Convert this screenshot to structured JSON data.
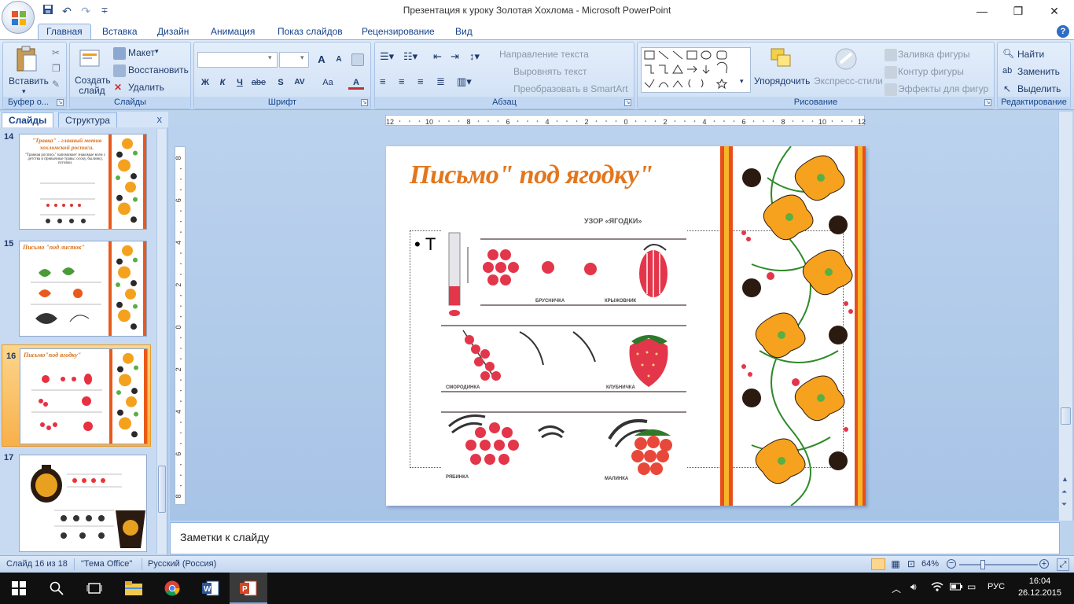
{
  "window": {
    "title": "Презентация к уроку Золотая Хохлома - Microsoft PowerPoint"
  },
  "quick_access": {
    "icons": [
      "save-icon",
      "undo-icon",
      "redo-icon",
      "customize-icon"
    ],
    "customize_glyph": "∓"
  },
  "window_controls": {
    "minimize": "—",
    "restore": "❐",
    "close": "✕"
  },
  "tabs": [
    "Главная",
    "Вставка",
    "Дизайн",
    "Анимация",
    "Показ слайдов",
    "Рецензирование",
    "Вид"
  ],
  "ribbon": {
    "clipboard": {
      "paste": "Вставить",
      "label": "Буфер о..."
    },
    "slides": {
      "new_slide": "Создать слайд",
      "layout": "Макет",
      "reset": "Восстановить",
      "delete": "Удалить",
      "label": "Слайды"
    },
    "font": {
      "label": "Шрифт",
      "bold": "Ж",
      "italic": "К",
      "underline": "Ч",
      "strike": "abe",
      "shadow": "S",
      "spacing": "AV",
      "case": "Aa",
      "color": "A",
      "grow": "A",
      "shrink": "A"
    },
    "paragraph": {
      "text_direction": "Направление текста",
      "align_text": "Выровнять текст",
      "smartart": "Преобразовать в SmartArt",
      "label": "Абзац"
    },
    "drawing": {
      "arrange": "Упорядочить",
      "quick_styles": "Экспресс-стили",
      "fill": "Заливка фигуры",
      "outline": "Контур фигуры",
      "effects": "Эффекты для фигур",
      "label": "Рисование"
    },
    "editing": {
      "find": "Найти",
      "replace": "Заменить",
      "select": "Выделить",
      "label": "Редактирование"
    }
  },
  "left_pane": {
    "tab_slides": "Слайды",
    "tab_outline": "Структура",
    "close": "x",
    "thumbnails": [
      {
        "num": "14",
        "title": "\"Травка\" - главный мотив хохломской росписи.",
        "body": "\"Травная роспись\" напоминает знакомые всем с детства и привычные травы: осоку, былинку, пуговки."
      },
      {
        "num": "15",
        "title": "Письмо \"под листок\"",
        "body": ""
      },
      {
        "num": "16",
        "title": "Письмо\"под ягодку\"",
        "body": ""
      },
      {
        "num": "17",
        "title": "",
        "body": ""
      }
    ],
    "selected": "16"
  },
  "ruler": {
    "h_labels": [
      "12",
      "10",
      "8",
      "6",
      "4",
      "2",
      "0",
      "2",
      "4",
      "6",
      "8",
      "10",
      "12"
    ],
    "v_labels": [
      "8",
      "6",
      "4",
      "2",
      "0",
      "2",
      "4",
      "6",
      "8"
    ]
  },
  "slide": {
    "title": "Письмо\" под ягодку\"",
    "bullet_char": "•",
    "bullet_text": "Т",
    "pattern": {
      "heading": "УЗОР «ЯГОДКИ»",
      "labels": [
        "БРУСНИЧКА",
        "КРЫЖОВНИК",
        "СМОРОДИНКА",
        "КЛУБНИЧКА",
        "РЯБИНКА",
        "МАЛИНКА"
      ]
    }
  },
  "notes": {
    "placeholder": "Заметки к слайду"
  },
  "status": {
    "slide": "Слайд 16 из 18",
    "theme": "\"Тема Office\"",
    "language": "Русский (Россия)",
    "zoom": "64%",
    "zoom_value": 0.64
  },
  "taskbar": {
    "lang": "РУС",
    "time": "16:04",
    "date": "26.12.2015"
  },
  "colors": {
    "accent_orange": "#e3761c",
    "ribbon_bg": "#dfeaf8",
    "selected_thumb": "#f8b04a"
  }
}
